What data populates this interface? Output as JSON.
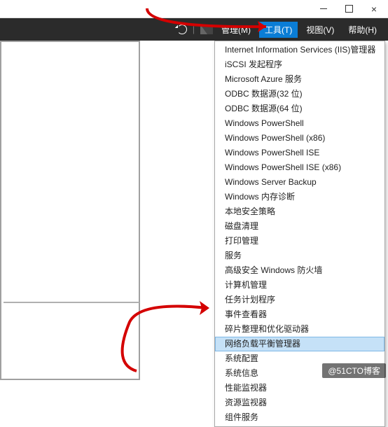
{
  "titlebar": {
    "minimize": "−",
    "maximize": "□",
    "close": "×"
  },
  "toolbar": {
    "separator": "|",
    "menu": {
      "manage": "管理(M)",
      "tools": "工具(T)",
      "view": "视图(V)",
      "help": "帮助(H)"
    }
  },
  "dropdown": {
    "items": [
      "Internet Information Services (IIS)管理器",
      "iSCSI 发起程序",
      "Microsoft Azure 服务",
      "ODBC 数据源(32 位)",
      "ODBC 数据源(64 位)",
      "Windows PowerShell",
      "Windows PowerShell (x86)",
      "Windows PowerShell ISE",
      "Windows PowerShell ISE (x86)",
      "Windows Server Backup",
      "Windows 内存诊断",
      "本地安全策略",
      "磁盘清理",
      "打印管理",
      "服务",
      "高级安全 Windows 防火墙",
      "计算机管理",
      "任务计划程序",
      "事件查看器",
      "碎片整理和优化驱动器",
      "网络负载平衡管理器",
      "系统配置",
      "系统信息",
      "性能监视器",
      "资源监视器",
      "组件服务"
    ],
    "highlighted_index": 20
  },
  "watermark": "@51CTO博客"
}
